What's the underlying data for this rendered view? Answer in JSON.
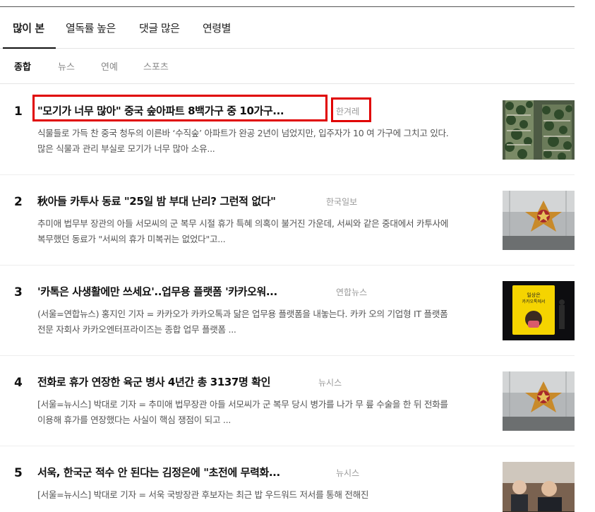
{
  "tabs": [
    {
      "label": "많이 본",
      "active": true
    },
    {
      "label": "열독률 높은",
      "active": false
    },
    {
      "label": "댓글 많은",
      "active": false
    },
    {
      "label": "연령별",
      "active": false
    }
  ],
  "subtabs": [
    {
      "label": "종합",
      "active": true
    },
    {
      "label": "뉴스",
      "active": false
    },
    {
      "label": "연예",
      "active": false
    },
    {
      "label": "스포츠",
      "active": false
    }
  ],
  "articles": [
    {
      "rank": "1",
      "title": "\"모기가 너무 많아\" 중국 숲아파트 8백가구 중 10가구...",
      "press": "한겨레",
      "summary": "식물들로 가득 찬 중국 청두의 이른바 ‘수직숲’ 아파트가 완공 2년이 넘었지만, 입주자가 10 여 가구에 그치고 있다. 많은 식물과 관리 부실로 모기가 너무 많아 소유...",
      "thumbnail": "forest-apartment-photo"
    },
    {
      "rank": "2",
      "title": "秋아들 카투사 동료 \"25일 밤 부대 난리? 그런적 없다\"",
      "press": "한국일보",
      "summary": "추미애 법무부 장관의 아들 서모씨의 군 복무 시절 휴가 특혜 의혹이 불거진 가운데, 서씨와 같은 중대에서 카투사에 복무했던 동료가 \"서씨의 휴가 미복귀는 없었다\"고...",
      "thumbnail": "army-emblem-photo"
    },
    {
      "rank": "3",
      "title": "'카톡은 사생활에만 쓰세요'..업무용 플랫폼 '카카오워...",
      "press": "연합뉴스",
      "summary": "(서울=연합뉴스) 홍지인 기자 = 카카오가 카카오톡과 닮은 업무용 플랫폼을 내놓는다. 카카 오의 기업형 IT 플랫폼 전문 자회사 카카오엔터프라이즈는 종합 업무 플랫폼 ...",
      "thumbnail": "presentation-stage-photo",
      "thumb_screen_text": [
        "일상은",
        "카카오톡에서"
      ]
    },
    {
      "rank": "4",
      "title": "전화로 휴가 연장한 육군 병사 4년간 총 3137명 확인",
      "press": "뉴시스",
      "summary": "[서울=뉴시스] 박대로 기자 = 추미애 법무장관 아들 서모씨가 군 복무 당시 병가를 나가 무 릎 수술을 한 뒤 전화를 이용해 휴가를 연장했다는 사실이 핵심 쟁점이 되고 ...",
      "thumbnail": "army-emblem-photo"
    },
    {
      "rank": "5",
      "title": "서욱, 한국군 적수 안 된다는 김정은에 \"초전에 무력화...",
      "press": "뉴시스",
      "summary": "[서울=뉴시스] 박대로 기자 = 서욱 국방장관 후보자는 최근 밥 우드워드 저서를 통해 전해진",
      "thumbnail": "hearing-photo"
    }
  ],
  "colors": {
    "highlight_box": "#e00000",
    "summary_text": "#555555",
    "press_text": "#999999"
  }
}
